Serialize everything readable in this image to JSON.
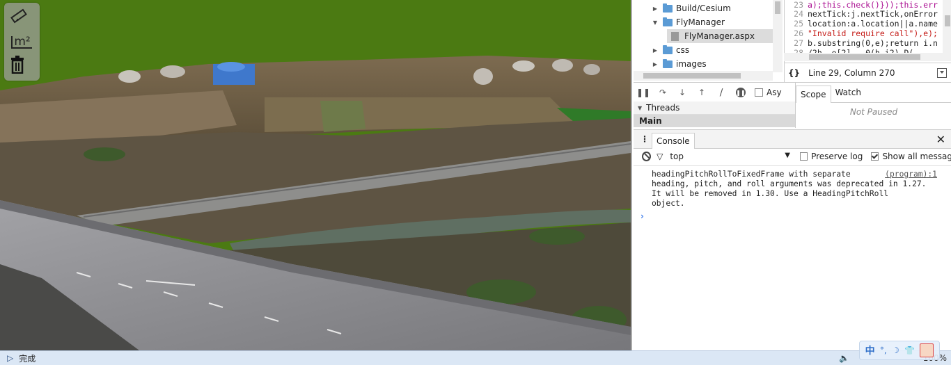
{
  "scene": {
    "tools": [
      {
        "icon": "ruler-icon",
        "label": ""
      },
      {
        "icon": "area-measure-icon",
        "label": "m²"
      },
      {
        "icon": "trash-icon",
        "label": ""
      }
    ],
    "colors": {
      "sky": "#4b7a12",
      "field": "#6e6148",
      "road": "#8a8a8e"
    }
  },
  "devtools": {
    "tree": [
      {
        "label": "Build/Cesium",
        "type": "folder",
        "expanded": false
      },
      {
        "label": "FlyManager",
        "type": "folder",
        "expanded": true
      },
      {
        "label": "FlyManager.aspx",
        "type": "file",
        "selected": true
      },
      {
        "label": "css",
        "type": "folder",
        "expanded": false
      },
      {
        "label": "images",
        "type": "folder",
        "expanded": false
      }
    ],
    "code": [
      {
        "ln": "23",
        "text": "a);this.check()}));this.err"
      },
      {
        "ln": "24",
        "text": "nextTick:j.nextTick,onError"
      },
      {
        "ln": "25",
        "text": "location:a.location||a.name"
      },
      {
        "ln": "26",
        "text": "\"Invalid require call\"),e);"
      },
      {
        "ln": "27",
        "text": "b.substring(0,e);return i.n"
      },
      {
        "ln": "28",
        "text": "/2h.  o[2] --0(h,i2) D("
      },
      {
        "ln": "29",
        "text": ""
      }
    ],
    "pretty_print": "{}",
    "cursor_position": "Line 29, Column 270",
    "async_label": "Asy",
    "side_tabs": {
      "scope": "Scope",
      "watch": "Watch"
    },
    "not_paused": "Not Paused",
    "threads_label": "Threads",
    "thread_main": "Main",
    "console_tab": "Console",
    "context": "top",
    "preserve_log": "Preserve log",
    "show_all": "Show all messag",
    "message": {
      "line1": "headingPitchRollToFixedFrame with separate",
      "source": "(program):1",
      "line2": "heading, pitch, and roll arguments was deprecated in 1.27.",
      "line3": "It will be removed in 1.30.  Use a HeadingPitchRoll",
      "line4": "object."
    },
    "prompt": "›"
  },
  "statusbar": {
    "status_text": "完成",
    "zoom": "100%",
    "ime": {
      "lang": "中"
    }
  }
}
